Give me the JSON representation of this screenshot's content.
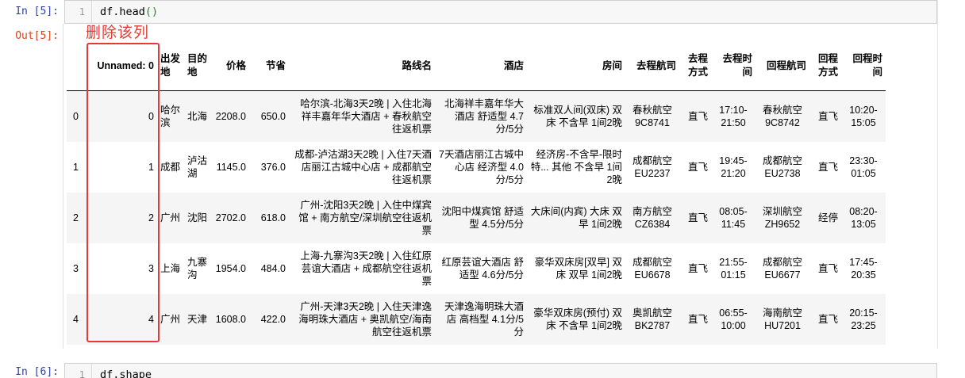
{
  "cell5": {
    "in_prompt": "In  [5]:",
    "out_prompt": "Out[5]:",
    "line_no": "1",
    "code_fn": "df.head",
    "code_parens": "()"
  },
  "annotation": {
    "text": "删除该列",
    "color": "#e53935"
  },
  "table": {
    "columns": [
      "Unnamed: 0",
      "出发地",
      "目的地",
      "价格",
      "节省",
      "路线名",
      "酒店",
      "房间",
      "去程航司",
      "去程方式",
      "去程时间",
      "回程航司",
      "回程方式",
      "回程时间"
    ],
    "rows": [
      {
        "index": "0",
        "unnamed": "0",
        "from": "哈尔滨",
        "to": "北海",
        "price": "2208.0",
        "save": "650.0",
        "route": "哈尔滨-北海3天2晚 | 入住北海祥丰嘉年华大酒店 + 春秋航空往返机票",
        "hotel": "北海祥丰嘉年华大酒店 舒适型 4.7分/5分",
        "room": "标准双人间(双床) 双床 不含早 1间2晚",
        "go_airline": "春秋航空 9C8741",
        "go_type": "直飞",
        "go_time": "17:10-21:50",
        "back_airline": "春秋航空 9C8742",
        "back_type": "直飞",
        "back_time": "10:20-15:05"
      },
      {
        "index": "1",
        "unnamed": "1",
        "from": "成都",
        "to": "泸沽湖",
        "price": "1145.0",
        "save": "376.0",
        "route": "成都-泸沽湖3天2晚 | 入住7天酒店丽江古城中心店 + 成都航空往返机票",
        "hotel": "7天酒店丽江古城中心店 经济型 4.0分/5分",
        "room": "经济房-不含早-限时特... 其他 不含早 1间2晚",
        "go_airline": "成都航空 EU2237",
        "go_type": "直飞",
        "go_time": "19:45-21:20",
        "back_airline": "成都航空 EU2738",
        "back_type": "直飞",
        "back_time": "23:30-01:05"
      },
      {
        "index": "2",
        "unnamed": "2",
        "from": "广州",
        "to": "沈阳",
        "price": "2702.0",
        "save": "618.0",
        "route": "广州-沈阳3天2晚 | 入住中煤宾馆 + 南方航空/深圳航空往返机票",
        "hotel": "沈阳中煤宾馆 舒适型 4.5分/5分",
        "room": "大床间(内宾) 大床 双早 1间2晚",
        "go_airline": "南方航空 CZ6384",
        "go_type": "直飞",
        "go_time": "08:05-11:45",
        "back_airline": "深圳航空 ZH9652",
        "back_type": "经停",
        "back_time": "08:20-13:05"
      },
      {
        "index": "3",
        "unnamed": "3",
        "from": "上海",
        "to": "九寨沟",
        "price": "1954.0",
        "save": "484.0",
        "route": "上海-九寨沟3天2晚 | 入住红原芸谊大酒店 + 成都航空往返机票",
        "hotel": "红原芸谊大酒店 舒适型 4.6分/5分",
        "room": "豪华双床房[双早] 双床 双早 1间2晚",
        "go_airline": "成都航空 EU6678",
        "go_type": "直飞",
        "go_time": "21:55-01:15",
        "back_airline": "成都航空 EU6677",
        "back_type": "直飞",
        "back_time": "17:45-20:35"
      },
      {
        "index": "4",
        "unnamed": "4",
        "from": "广州",
        "to": "天津",
        "price": "1608.0",
        "save": "422.0",
        "route": "广州-天津3天2晚 | 入住天津逸海明珠大酒店 + 奥凯航空/海南航空往返机票",
        "hotel": "天津逸海明珠大酒店 高档型 4.1分/5分",
        "room": "豪华双床房(预付) 双床 不含早 1间2晚",
        "go_airline": "奥凯航空 BK2787",
        "go_type": "直飞",
        "go_time": "06:55-10:00",
        "back_airline": "海南航空 HU7201",
        "back_type": "直飞",
        "back_time": "20:15-23:25"
      }
    ]
  },
  "cell6": {
    "in_prompt": "In  [6]:",
    "line_no": "1",
    "code": "df.shape"
  }
}
